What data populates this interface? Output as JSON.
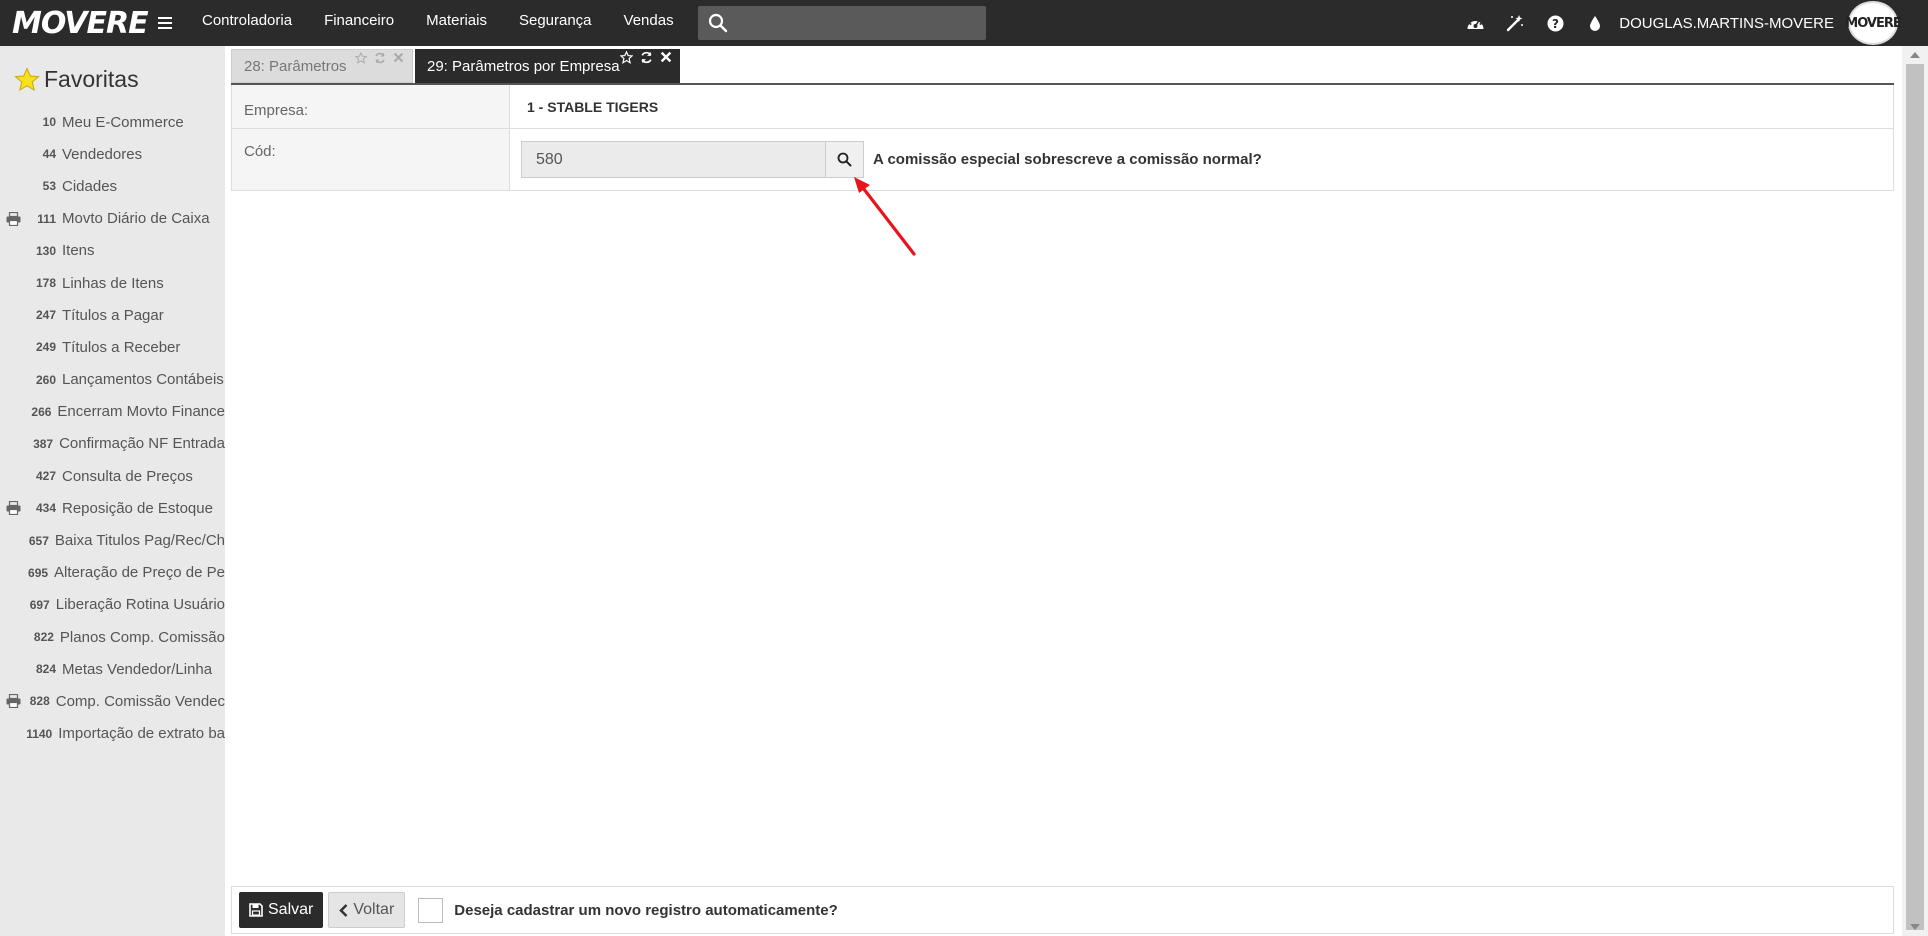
{
  "header": {
    "logo": "MOVERE",
    "menu": [
      "Controladoria",
      "Financeiro",
      "Materiais",
      "Segurança",
      "Vendas"
    ],
    "search_placeholder": "",
    "username": "DOUGLAS.MARTINS-MOVERE",
    "avatar_text": "MOVERE",
    "icons": [
      "dashboard-icon",
      "magic-wand-icon",
      "help-icon",
      "theme-drop-icon"
    ]
  },
  "sidebar": {
    "title": "Favoritas",
    "items": [
      {
        "code": "10",
        "label": "Meu E-Commerce",
        "print": false
      },
      {
        "code": "44",
        "label": "Vendedores",
        "print": false
      },
      {
        "code": "53",
        "label": "Cidades",
        "print": false
      },
      {
        "code": "111",
        "label": "Movto Diário de Caixa",
        "print": true
      },
      {
        "code": "130",
        "label": "Itens",
        "print": false
      },
      {
        "code": "178",
        "label": "Linhas de Itens",
        "print": false
      },
      {
        "code": "247",
        "label": "Títulos a Pagar",
        "print": false
      },
      {
        "code": "249",
        "label": "Títulos a Receber",
        "print": false
      },
      {
        "code": "260",
        "label": "Lançamentos Contábeis",
        "print": false
      },
      {
        "code": "266",
        "label": "Encerram Movto Finance",
        "print": false
      },
      {
        "code": "387",
        "label": "Confirmação NF Entrada",
        "print": false
      },
      {
        "code": "427",
        "label": "Consulta de Preços",
        "print": false
      },
      {
        "code": "434",
        "label": "Reposição de Estoque",
        "print": true
      },
      {
        "code": "657",
        "label": "Baixa Titulos Pag/Rec/Ch",
        "print": false
      },
      {
        "code": "695",
        "label": "Alteração de Preço de Pe",
        "print": false
      },
      {
        "code": "697",
        "label": "Liberação Rotina Usuário",
        "print": false
      },
      {
        "code": "822",
        "label": "Planos Comp. Comissão",
        "print": false
      },
      {
        "code": "824",
        "label": "Metas Vendedor/Linha",
        "print": false
      },
      {
        "code": "828",
        "label": "Comp. Comissão Vendec",
        "print": true
      },
      {
        "code": "1140",
        "label": "Importação de extrato ba",
        "print": false
      }
    ]
  },
  "tabs": [
    {
      "label": "28: Parâmetros",
      "active": false
    },
    {
      "label": "29: Parâmetros por Empresa",
      "active": true
    }
  ],
  "form": {
    "empresa_label": "Empresa:",
    "empresa_value": "1 - STABLE TIGERS",
    "cod_label": "Cód:",
    "cod_value": "580",
    "question": "A comissão especial sobrescreve a comissão normal?"
  },
  "footer": {
    "save_label": "Salvar",
    "back_label": "Voltar",
    "auto_register_label": "Deseja cadastrar um novo registro automaticamente?",
    "auto_register_checked": false
  },
  "colors": {
    "topbar": "#2b2b2b",
    "sidebar": "#e9e9e9",
    "annotation_arrow": "#e8131b"
  }
}
